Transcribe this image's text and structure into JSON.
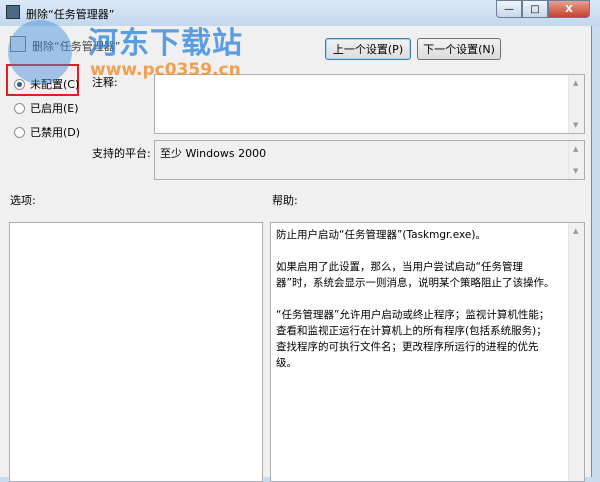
{
  "window": {
    "title": "删除“任务管理器”",
    "min": "—",
    "max": "□",
    "close": "X"
  },
  "header": {
    "subtitle": "删除“任务管理器”",
    "prev": "上一个设置(P)",
    "next": "下一个设置(N)"
  },
  "radios": [
    {
      "label": "未配置(C)",
      "checked": true
    },
    {
      "label": "已启用(E)",
      "checked": false
    },
    {
      "label": "已禁用(D)",
      "checked": false
    }
  ],
  "comment_label": "注释:",
  "platform_label": "支持的平台:",
  "platform_value": "至少 Windows 2000",
  "options_label": "选项:",
  "help_label": "帮助:",
  "help_paragraphs": [
    "防止用户启动“任务管理器”(Taskmgr.exe)。",
    "如果启用了此设置，那么，当用户尝试启动“任务管理器”时，系统会显示一则消息，说明某个策略阻止了该操作。",
    "“任务管理器”允许用户启动或终止程序；监视计算机性能；查看和监视正运行在计算机上的所有程序(包括系统服务)；查找程序的可执行文件名；更改程序所运行的进程的优先级。"
  ],
  "watermark": {
    "name": "河东下载站",
    "url": "www.pc0359.cn"
  },
  "colors": {
    "highlight": "#e02020",
    "titlebar": "#c3d7ee"
  }
}
